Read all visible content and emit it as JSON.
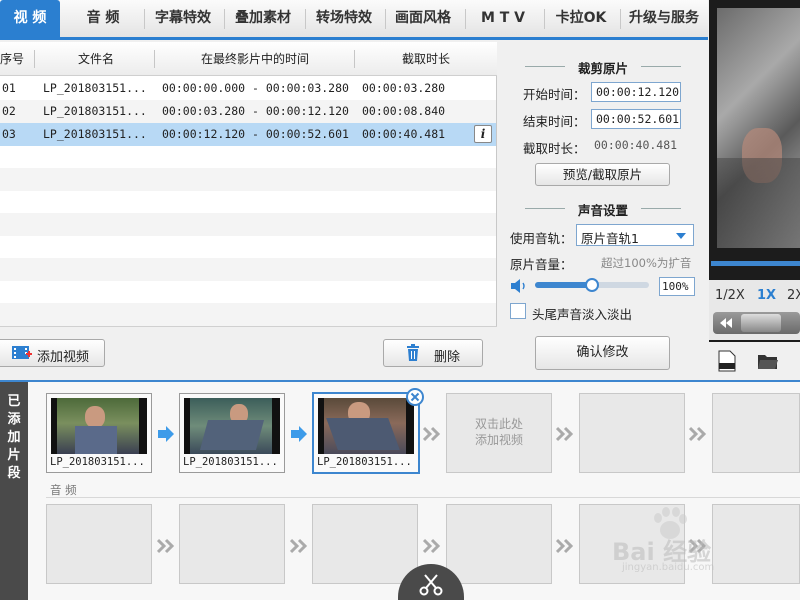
{
  "tabs": [
    {
      "label": "视 频",
      "active": true
    },
    {
      "label": "音 频",
      "active": false
    },
    {
      "label": "字幕特效",
      "active": false
    },
    {
      "label": "叠加素材",
      "active": false
    },
    {
      "label": "转场特效",
      "active": false
    },
    {
      "label": "画面风格",
      "active": false
    },
    {
      "label": "M T V",
      "active": false
    },
    {
      "label": "卡拉OK",
      "active": false
    },
    {
      "label": "升级与服务",
      "active": false
    }
  ],
  "table": {
    "headers": [
      "序号",
      "文件名",
      "在最终影片中的时间",
      "截取时长"
    ],
    "rows": [
      {
        "no": "01",
        "file": "LP_201803151...",
        "time": "00:00:00.000 - 00:00:03.280",
        "dur": "00:00:03.280",
        "selected": false
      },
      {
        "no": "02",
        "file": "LP_201803151...",
        "time": "00:00:03.280 - 00:00:12.120",
        "dur": "00:00:08.840",
        "selected": false
      },
      {
        "no": "03",
        "file": "LP_201803151...",
        "time": "00:00:12.120 - 00:00:52.601",
        "dur": "00:00:40.481",
        "selected": true
      }
    ],
    "info_glyph": "i"
  },
  "list_footer": {
    "add_video": "添加视频",
    "delete": "删除"
  },
  "trim": {
    "section_title": "裁剪原片",
    "start_label": "开始时间：",
    "start_value": "00:00:12.120",
    "end_label": "结束时间：",
    "end_value": "00:00:52.601",
    "duration_label": "截取时长：",
    "duration_value": "00:00:40.481",
    "preview_button": "预览/截取原片"
  },
  "audio": {
    "section_title": "声音设置",
    "track_label": "使用音轨：",
    "track_value": "原片音轨1",
    "volume_label": "原片音量：",
    "volume_hint": "超过100%为扩音",
    "volume_value": "100%",
    "volume_level": 0.5,
    "fade_label": "头尾声音淡入淡出",
    "fade_checked": false,
    "confirm_button": "确认修改"
  },
  "player": {
    "speed_options": [
      "1/2X",
      "1X",
      "2X"
    ],
    "active_speed": "1X",
    "progress": 1.0
  },
  "timeline": {
    "side_tab": [
      "已",
      "添",
      "加",
      "片",
      "段"
    ],
    "clips": [
      {
        "name": "LP_201803151..."
      },
      {
        "name": "LP_201803151..."
      },
      {
        "name": "LP_201803151..."
      }
    ],
    "placeholder_text": [
      "双击此处",
      "添加视频"
    ],
    "audio_track_label": "音 频"
  },
  "watermark": {
    "brand": "Bai 经验",
    "url": "jingyan.baidu.com"
  },
  "colors": {
    "accent": "#2b7fd0",
    "selected_row": "#b8d9f5",
    "timeline_arrow": "#3d9be9"
  }
}
